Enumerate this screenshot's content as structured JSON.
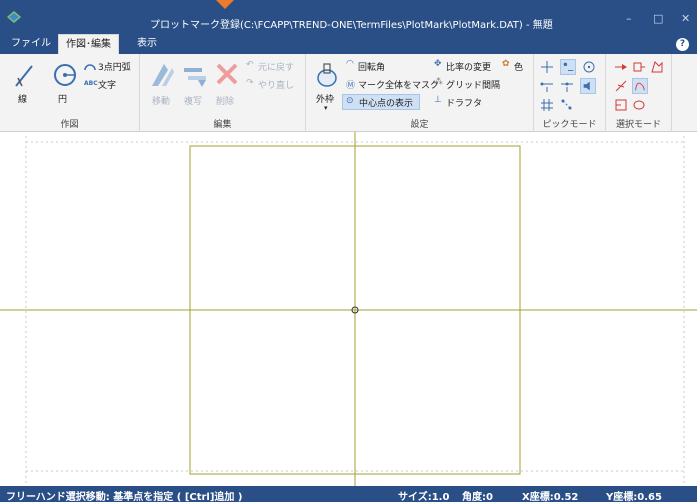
{
  "window": {
    "title": "プロットマーク登録(C:\\FCAPP\\TREND-ONE\\TermFiles\\PlotMark\\PlotMark.DAT) - 無題",
    "minimize": "–",
    "maximize": "□",
    "close": "✕"
  },
  "menu": {
    "items": [
      {
        "label": "ファイル"
      },
      {
        "label": "作図･編集"
      },
      {
        "label": "表示"
      }
    ],
    "help": "?"
  },
  "ribbon": {
    "draw": {
      "label": "作図",
      "line": "線",
      "circle": "円",
      "arc3": "3点円弧",
      "text": "文字",
      "text_badge": "ABC"
    },
    "edit": {
      "label": "編集",
      "move": "移動",
      "copy": "複写",
      "delete": "削除",
      "undo": "元に戻す",
      "redo": "やり直し"
    },
    "settings": {
      "label": "設定",
      "outer_frame": "外枠",
      "rotation": "回転角",
      "mask_all": "マーク全体をマスク",
      "show_center": "中心点の表示",
      "scale_change": "比率の変更",
      "color": "色",
      "grid_spacing": "グリッド間隔",
      "drafter": "ドラフタ"
    },
    "pick_mode": {
      "label": "ピックモード"
    },
    "select_mode": {
      "label": "選択モード"
    }
  },
  "status": {
    "message": "フリーハンド選択移動: 基準点を指定 ( [Ctrl]追加 )",
    "size": "サイズ:1.0",
    "angle": "角度:0",
    "x_coord": "X座標:0.52",
    "y_coord": "Y座標:0.65"
  },
  "colors": {
    "titlebar": "#2a4f86",
    "accent_arrow": "#f07a2c",
    "drawing_line": "#a3a030",
    "ribbon_bg": "#f3f3f3",
    "status_bg": "#2a4f86"
  }
}
